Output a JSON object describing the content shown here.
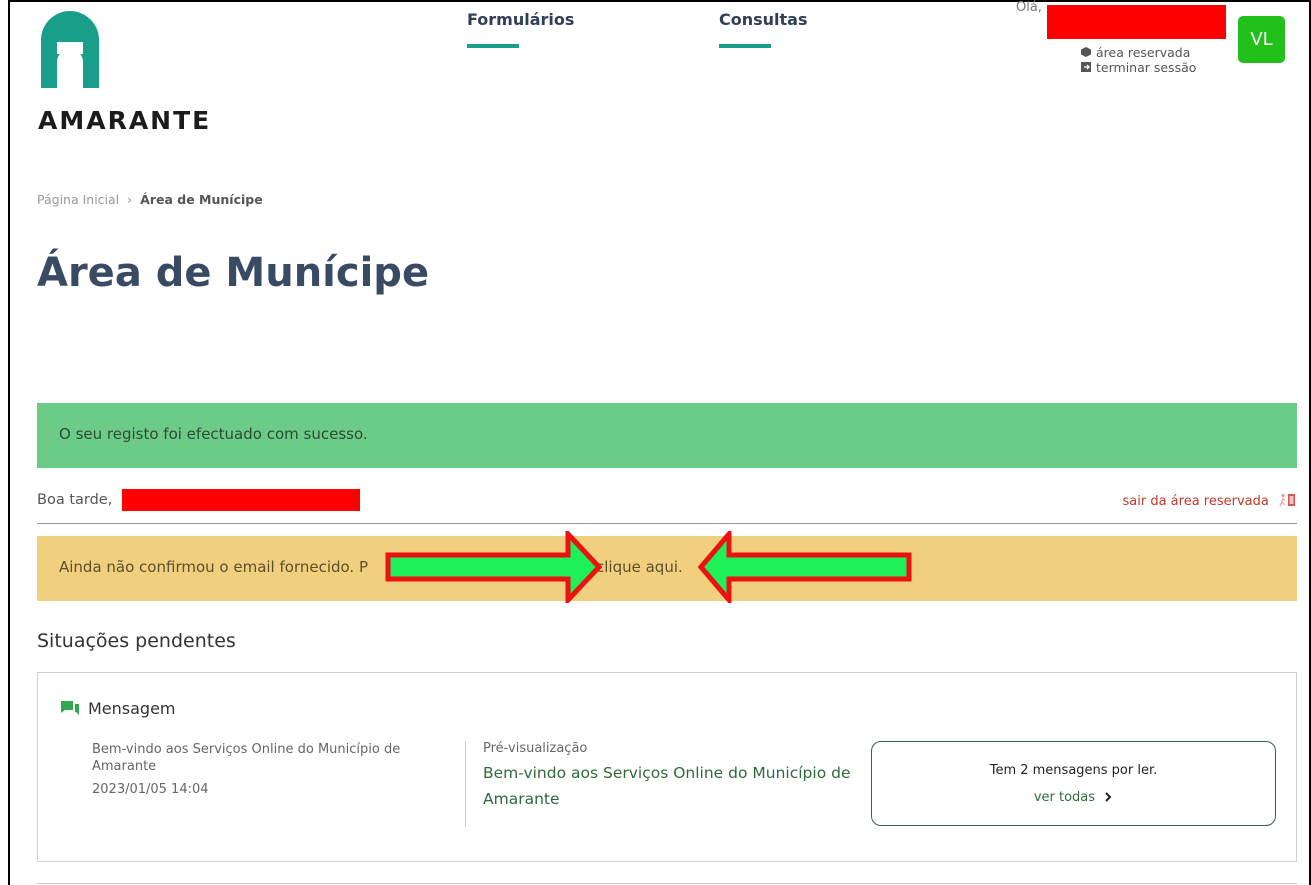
{
  "header": {
    "brand": "AMARANTE",
    "nav": [
      {
        "label": "Formulários"
      },
      {
        "label": "Consultas"
      }
    ],
    "greeting": "Olá,",
    "user_links": {
      "reserved_area": "área reservada",
      "logout": "terminar sessão"
    },
    "avatar_initials": "VL",
    "colors": {
      "brand": "#1a9e8c",
      "avatar": "#22c01a"
    }
  },
  "breadcrumb": {
    "home": "Página Inicial",
    "current": "Área de Munícipe"
  },
  "page_title": "Área de Munícipe",
  "alerts": {
    "success": "O seu registo foi efectuado com sucesso.",
    "greeting": "Boa tarde,",
    "logout_link": "sair da área reservada",
    "warning_prefix": "Ainda não confirmou o email fornecido. P",
    "warning_link": "clique aqui."
  },
  "pending": {
    "title": "Situações pendentes",
    "message_card": {
      "heading": "Mensagem",
      "subject": "Bem-vindo aos Serviços Online do Município de Amarante",
      "date": "2023/01/05 14:04",
      "preview_label": "Pré-visualização",
      "preview_text": "Bem-vindo aos Serviços Online do Município de Amarante",
      "unread_text": "Tem 2 mensagens por ler.",
      "view_all": "ver todas"
    }
  }
}
